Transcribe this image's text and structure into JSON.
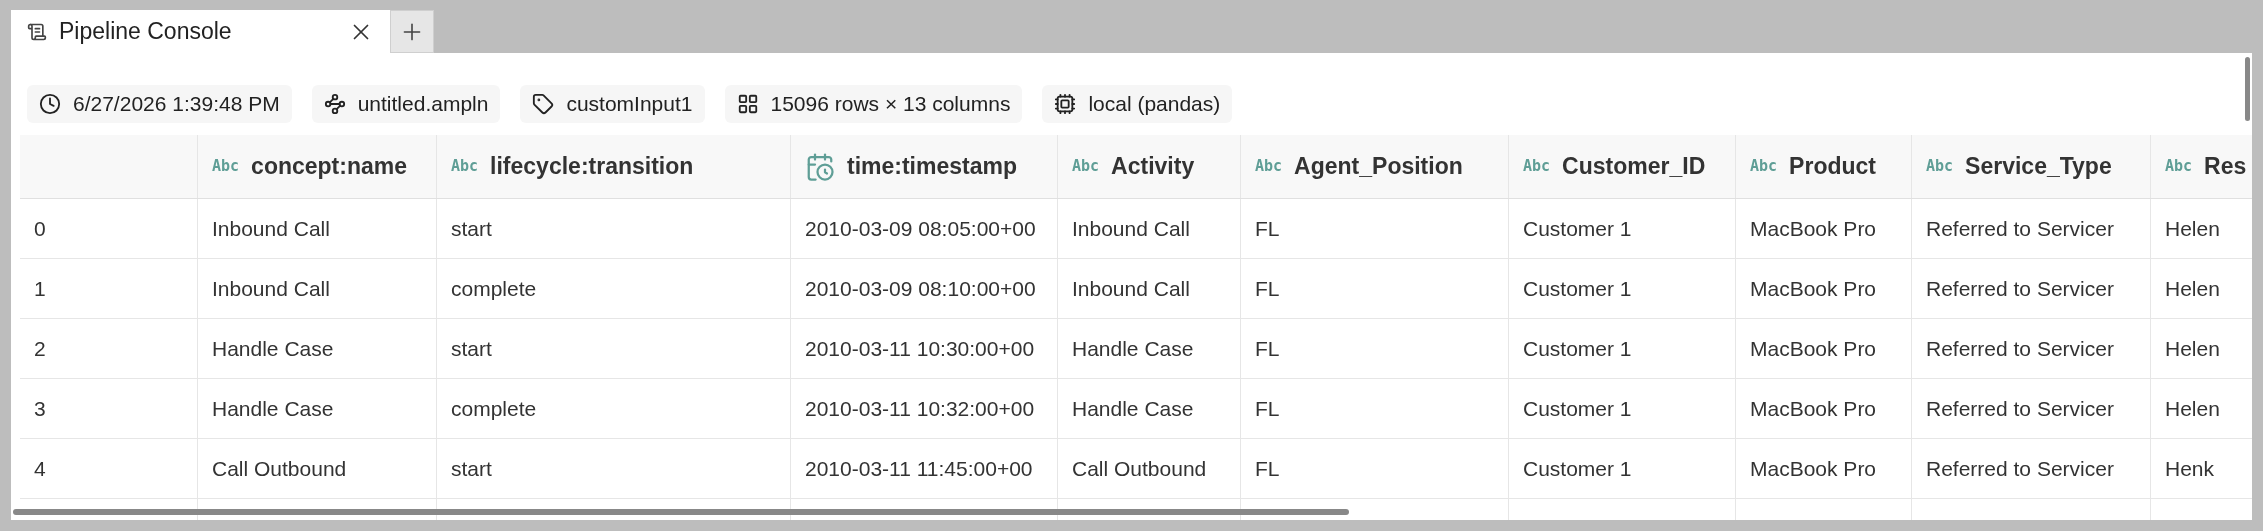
{
  "tab": {
    "title": "Pipeline Console",
    "selected": true
  },
  "chips": [
    {
      "kind": "time",
      "label": "6/27/2026 1:39:48 PM"
    },
    {
      "kind": "file",
      "label": "untitled.ampln"
    },
    {
      "kind": "tag",
      "label": "customInput1"
    },
    {
      "kind": "size",
      "label": "15096 rows × 13 columns"
    },
    {
      "kind": "engine",
      "label": "local (pandas)"
    }
  ],
  "table": {
    "columns": [
      {
        "kind": "text",
        "badge": "Abc",
        "label": "concept:name"
      },
      {
        "kind": "text",
        "badge": "Abc",
        "label": "lifecycle:transition"
      },
      {
        "kind": "datetime",
        "label": "time:timestamp"
      },
      {
        "kind": "text",
        "badge": "Abc",
        "label": "Activity"
      },
      {
        "kind": "text",
        "badge": "Abc",
        "label": "Agent_Position"
      },
      {
        "kind": "text",
        "badge": "Abc",
        "label": "Customer_ID"
      },
      {
        "kind": "text",
        "badge": "Abc",
        "label": "Product"
      },
      {
        "kind": "text",
        "badge": "Abc",
        "label": "Service_Type"
      },
      {
        "kind": "text",
        "badge": "Abc",
        "label": "Res"
      }
    ],
    "rows": [
      {
        "index": "0",
        "cells": [
          "Inbound Call",
          "start",
          "2010-03-09 08:05:00+00",
          "Inbound Call",
          "FL",
          "Customer 1",
          "MacBook Pro",
          "Referred to Servicer",
          "Helen"
        ]
      },
      {
        "index": "1",
        "cells": [
          "Inbound Call",
          "complete",
          "2010-03-09 08:10:00+00",
          "Inbound Call",
          "FL",
          "Customer 1",
          "MacBook Pro",
          "Referred to Servicer",
          "Helen"
        ]
      },
      {
        "index": "2",
        "cells": [
          "Handle Case",
          "start",
          "2010-03-11 10:30:00+00",
          "Handle Case",
          "FL",
          "Customer 1",
          "MacBook Pro",
          "Referred to Servicer",
          "Helen"
        ]
      },
      {
        "index": "3",
        "cells": [
          "Handle Case",
          "complete",
          "2010-03-11 10:32:00+00",
          "Handle Case",
          "FL",
          "Customer 1",
          "MacBook Pro",
          "Referred to Servicer",
          "Helen"
        ]
      },
      {
        "index": "4",
        "cells": [
          "Call Outbound",
          "start",
          "2010-03-11 11:45:00+00",
          "Call Outbound",
          "FL",
          "Customer 1",
          "MacBook Pro",
          "Referred to Servicer",
          "Henk"
        ]
      }
    ]
  }
}
